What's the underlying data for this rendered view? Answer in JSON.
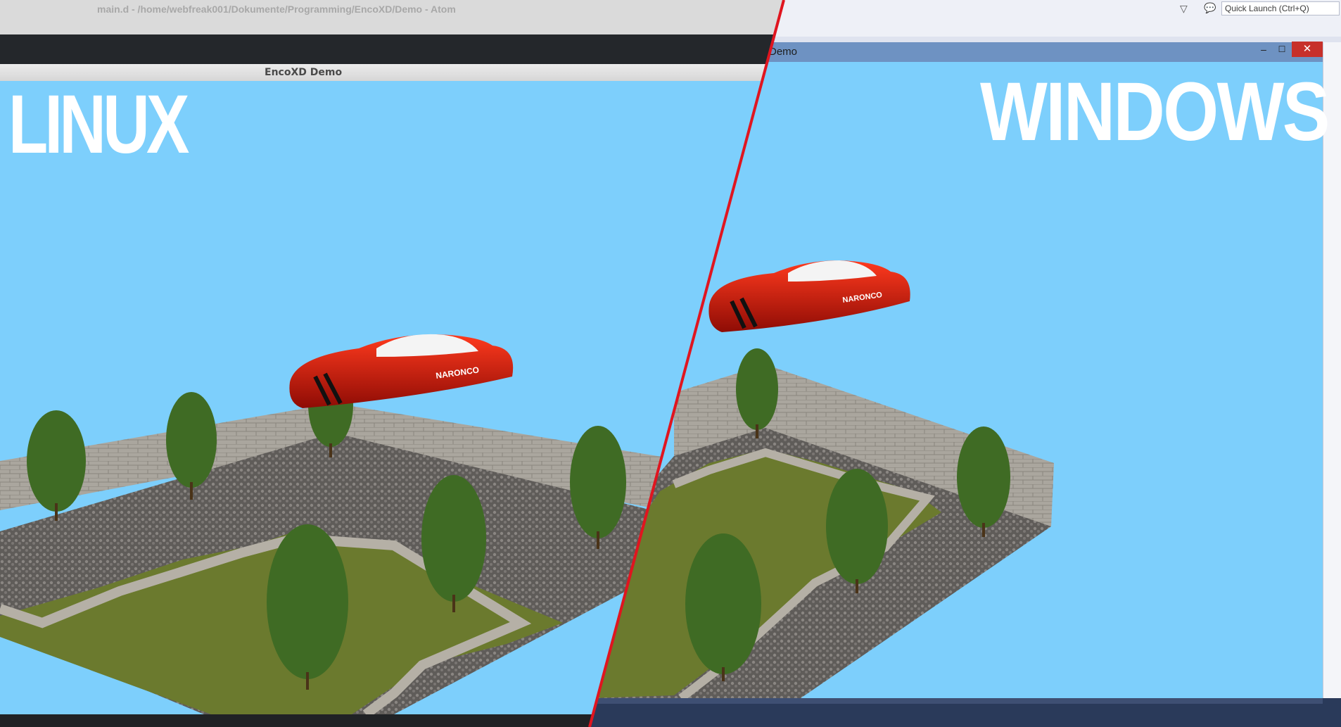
{
  "atom": {
    "window_title": "main.d - /home/webfreak001/Dokumente/Programming/EncoXD/Demo - Atom"
  },
  "linux_window": {
    "title": "EncoXD Demo",
    "overlay_label": "LINUX"
  },
  "vs": {
    "quick_launch_placeholder": "Quick Launch (Ctrl+Q)"
  },
  "windows_window": {
    "title": "Demo",
    "minimize_symbol": "–",
    "maximize_symbol": "☐",
    "close_symbol": "✕",
    "overlay_label": "WINDOWS"
  },
  "scene": {
    "car_text": "NARONCO",
    "sky_color": "#7dcffc",
    "car_color": "#d81b0b",
    "grass_color": "#6b7a2e",
    "wall_color": "#a9a59c",
    "gravel_color": "#6b6865",
    "tree_color": "#3f6b24",
    "divider_color": "#e0151f"
  }
}
